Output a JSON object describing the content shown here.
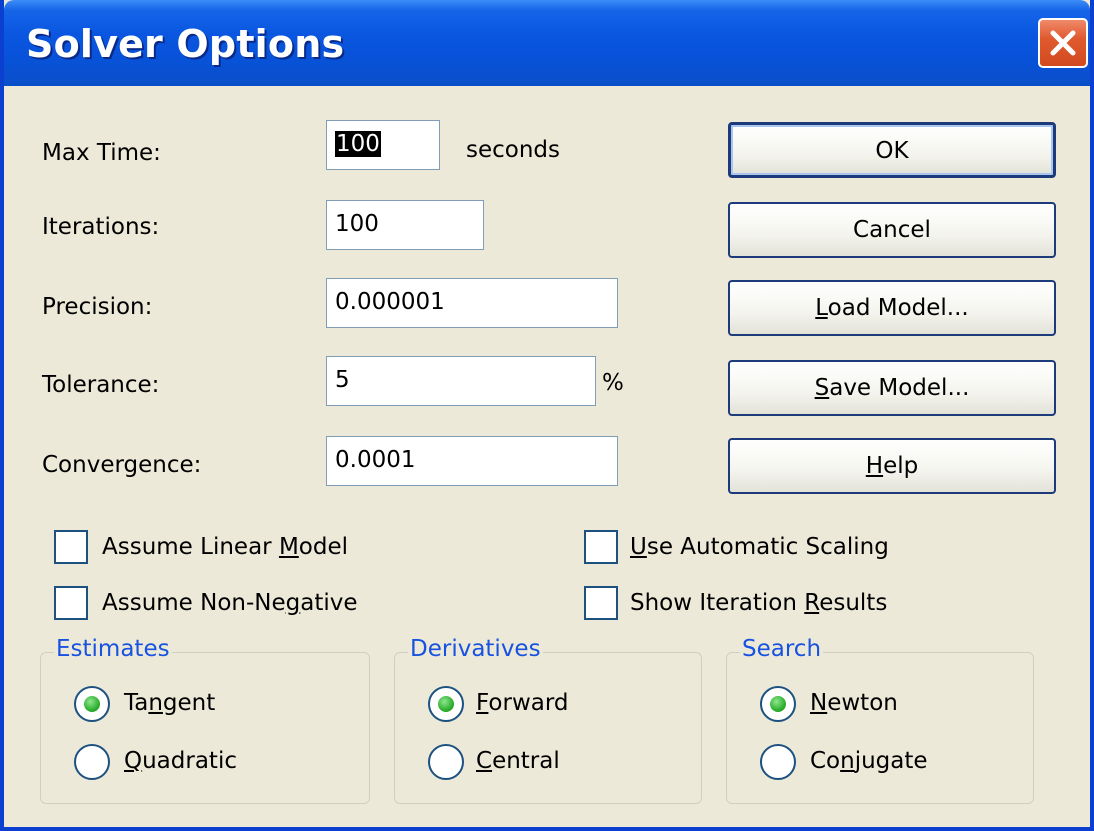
{
  "window": {
    "title": "Solver Options"
  },
  "fields": {
    "max_time": {
      "label": "Max Time:",
      "value": "100",
      "unit": "seconds"
    },
    "iterations": {
      "label": "Iterations:",
      "value": "100"
    },
    "precision": {
      "label": "Precision:",
      "value": "0.000001"
    },
    "tolerance": {
      "label": "Tolerance:",
      "value": "5",
      "unit": "%"
    },
    "convergence": {
      "label": "Convergence:",
      "value": "0.0001"
    }
  },
  "buttons": {
    "ok": "OK",
    "cancel": "Cancel",
    "load_model": {
      "pre": "",
      "ul": "L",
      "post": "oad Model..."
    },
    "save_model": {
      "pre": "",
      "ul": "S",
      "post": "ave Model..."
    },
    "help": {
      "pre": "",
      "ul": "H",
      "post": "elp"
    }
  },
  "checkboxes": {
    "assume_linear": {
      "pre": "Assume Linear ",
      "ul": "M",
      "post": "odel",
      "checked": false
    },
    "assume_nonneg": {
      "pre": "Assume Non-Ne",
      "ul": "g",
      "post": "ative",
      "checked": false
    },
    "auto_scaling": {
      "pre": "",
      "ul": "U",
      "post": "se Automatic Scaling",
      "checked": false
    },
    "show_iter": {
      "pre": "Show Iteration ",
      "ul": "R",
      "post": "esults",
      "checked": false
    }
  },
  "groups": {
    "estimates": {
      "legend": "Estimates",
      "options": [
        {
          "pre": "Ta",
          "ul": "n",
          "post": "gent",
          "selected": true
        },
        {
          "pre": "",
          "ul": "Q",
          "post": "uadratic",
          "selected": false
        }
      ]
    },
    "derivatives": {
      "legend": "Derivatives",
      "options": [
        {
          "pre": "",
          "ul": "F",
          "post": "orward",
          "selected": true
        },
        {
          "pre": "",
          "ul": "C",
          "post": "entral",
          "selected": false
        }
      ]
    },
    "search": {
      "legend": "Search",
      "options": [
        {
          "pre": "",
          "ul": "N",
          "post": "ewton",
          "selected": true
        },
        {
          "pre": "Co",
          "ul": "n",
          "post": "jugate",
          "selected": false
        }
      ]
    }
  },
  "colors": {
    "title_bar": "#0a56e0",
    "dialog_bg": "#ece9d8",
    "group_legend": "#1752e0",
    "radio_selected": "#2fb02f",
    "close_button": "#e05a30"
  },
  "icons": {
    "close": "close-icon"
  }
}
